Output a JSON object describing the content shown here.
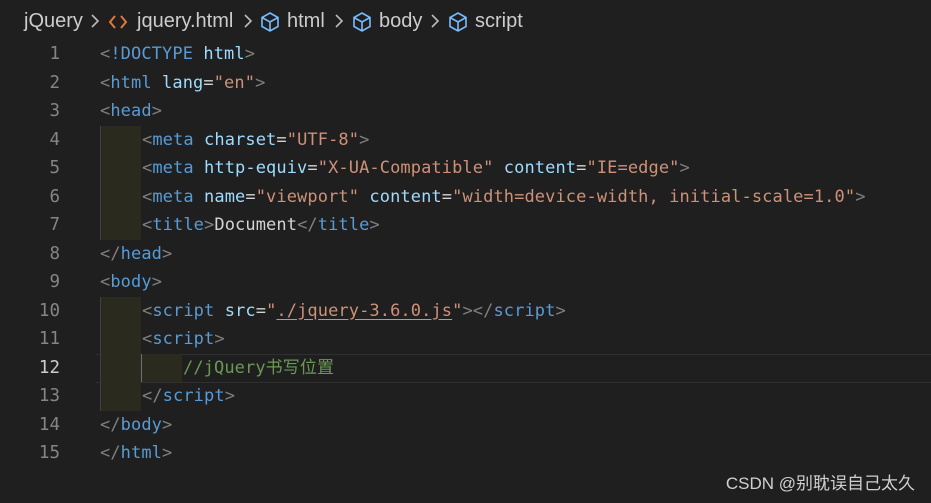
{
  "breadcrumb": {
    "items": [
      "jQuery",
      "jquery.html",
      "html",
      "body",
      "script"
    ]
  },
  "lines": [
    {
      "n": "1",
      "indent": 0,
      "tokens": [
        [
          "ang",
          "<"
        ],
        [
          "tag",
          "!DOCTYPE"
        ],
        [
          "txt",
          " "
        ],
        [
          "attr",
          "html"
        ],
        [
          "ang",
          ">"
        ]
      ]
    },
    {
      "n": "2",
      "indent": 0,
      "tokens": [
        [
          "ang",
          "<"
        ],
        [
          "tag",
          "html"
        ],
        [
          "txt",
          " "
        ],
        [
          "attr",
          "lang"
        ],
        [
          "eq",
          "="
        ],
        [
          "str",
          "\"en\""
        ],
        [
          "ang",
          ">"
        ]
      ]
    },
    {
      "n": "3",
      "indent": 0,
      "tokens": [
        [
          "ang",
          "<"
        ],
        [
          "tag",
          "head"
        ],
        [
          "ang",
          ">"
        ]
      ]
    },
    {
      "n": "4",
      "indent": 1,
      "tokens": [
        [
          "ang",
          "<"
        ],
        [
          "tag",
          "meta"
        ],
        [
          "txt",
          " "
        ],
        [
          "attr",
          "charset"
        ],
        [
          "eq",
          "="
        ],
        [
          "str",
          "\"UTF-8\""
        ],
        [
          "ang",
          ">"
        ]
      ]
    },
    {
      "n": "5",
      "indent": 1,
      "tokens": [
        [
          "ang",
          "<"
        ],
        [
          "tag",
          "meta"
        ],
        [
          "txt",
          " "
        ],
        [
          "attr",
          "http-equiv"
        ],
        [
          "eq",
          "="
        ],
        [
          "str",
          "\"X-UA-Compatible\""
        ],
        [
          "txt",
          " "
        ],
        [
          "attr",
          "content"
        ],
        [
          "eq",
          "="
        ],
        [
          "str",
          "\"IE=edge\""
        ],
        [
          "ang",
          ">"
        ]
      ]
    },
    {
      "n": "6",
      "indent": 1,
      "tokens": [
        [
          "ang",
          "<"
        ],
        [
          "tag",
          "meta"
        ],
        [
          "txt",
          " "
        ],
        [
          "attr",
          "name"
        ],
        [
          "eq",
          "="
        ],
        [
          "str",
          "\"viewport\""
        ],
        [
          "txt",
          " "
        ],
        [
          "attr",
          "content"
        ],
        [
          "eq",
          "="
        ],
        [
          "str",
          "\"width=device-width, initial-scale=1.0\""
        ],
        [
          "ang",
          ">"
        ]
      ]
    },
    {
      "n": "7",
      "indent": 1,
      "tokens": [
        [
          "ang",
          "<"
        ],
        [
          "tag",
          "title"
        ],
        [
          "ang",
          ">"
        ],
        [
          "txt",
          "Document"
        ],
        [
          "ang",
          "</"
        ],
        [
          "tag",
          "title"
        ],
        [
          "ang",
          ">"
        ]
      ]
    },
    {
      "n": "8",
      "indent": 0,
      "tokens": [
        [
          "ang",
          "</"
        ],
        [
          "tag",
          "head"
        ],
        [
          "ang",
          ">"
        ]
      ]
    },
    {
      "n": "9",
      "indent": 0,
      "tokens": [
        [
          "ang",
          "<"
        ],
        [
          "tag",
          "body"
        ],
        [
          "ang",
          ">"
        ]
      ]
    },
    {
      "n": "10",
      "indent": 1,
      "tokens": [
        [
          "ang",
          "<"
        ],
        [
          "tag",
          "script"
        ],
        [
          "txt",
          " "
        ],
        [
          "attr",
          "src"
        ],
        [
          "eq",
          "="
        ],
        [
          "str",
          "\""
        ],
        [
          "str u",
          "./jquery-3.6.0.js"
        ],
        [
          "str",
          "\""
        ],
        [
          "ang",
          "></"
        ],
        [
          "tag",
          "script"
        ],
        [
          "ang",
          ">"
        ]
      ]
    },
    {
      "n": "11",
      "indent": 1,
      "tokens": [
        [
          "ang",
          "<"
        ],
        [
          "tag",
          "script"
        ],
        [
          "ang",
          ">"
        ]
      ]
    },
    {
      "n": "12",
      "indent": 2,
      "active": true,
      "tokens": [
        [
          "cmt",
          "//jQuery书写位置"
        ]
      ]
    },
    {
      "n": "13",
      "indent": 1,
      "tokens": [
        [
          "ang",
          "</"
        ],
        [
          "tag",
          "script"
        ],
        [
          "ang",
          ">"
        ]
      ]
    },
    {
      "n": "14",
      "indent": 0,
      "tokens": [
        [
          "ang",
          "</"
        ],
        [
          "tag",
          "body"
        ],
        [
          "ang",
          ">"
        ]
      ]
    },
    {
      "n": "15",
      "indent": 0,
      "tokens": [
        [
          "ang",
          "</"
        ],
        [
          "tag",
          "html"
        ],
        [
          "ang",
          ">"
        ]
      ]
    }
  ],
  "watermark": "CSDN @别耽误自己太久",
  "colors": {
    "background": "#1f1f1f",
    "tag": "#569cd6",
    "attribute": "#9cdcfe",
    "string": "#ce9178",
    "comment": "#6a9955",
    "punctuation": "#808080"
  }
}
